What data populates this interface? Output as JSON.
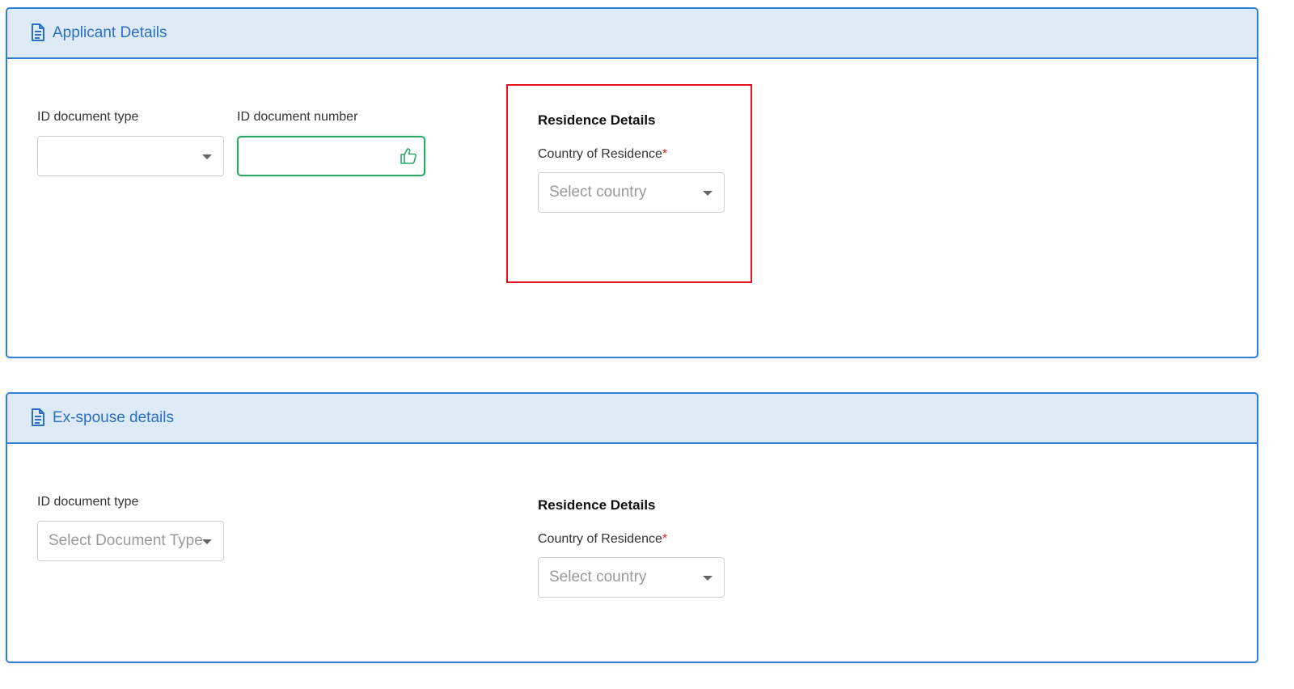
{
  "applicant": {
    "title": "Applicant Details",
    "id_doc_type_label": "ID document type",
    "id_doc_type_value": "",
    "id_doc_number_label": "ID document number",
    "id_doc_number_value": "",
    "residence_title": "Residence Details",
    "country_label": "Country of Residence",
    "required_mark": "*",
    "country_placeholder": "Select country"
  },
  "exspouse": {
    "title": "Ex-spouse details",
    "id_doc_type_label": "ID document type",
    "id_doc_type_placeholder": "Select Document Type",
    "residence_title": "Residence Details",
    "country_label": "Country of Residence",
    "required_mark": "*",
    "country_placeholder": "Select country"
  },
  "colors": {
    "accent_blue": "#2f7fd3",
    "header_bg": "#deebf7",
    "valid_green": "#2aa86a",
    "required_red": "#d62828",
    "highlight_red": "#e3141d"
  },
  "icons": {
    "section_header": "document-icon",
    "valid_input": "thumbs-up-icon",
    "dropdown": "caret-down-icon"
  }
}
